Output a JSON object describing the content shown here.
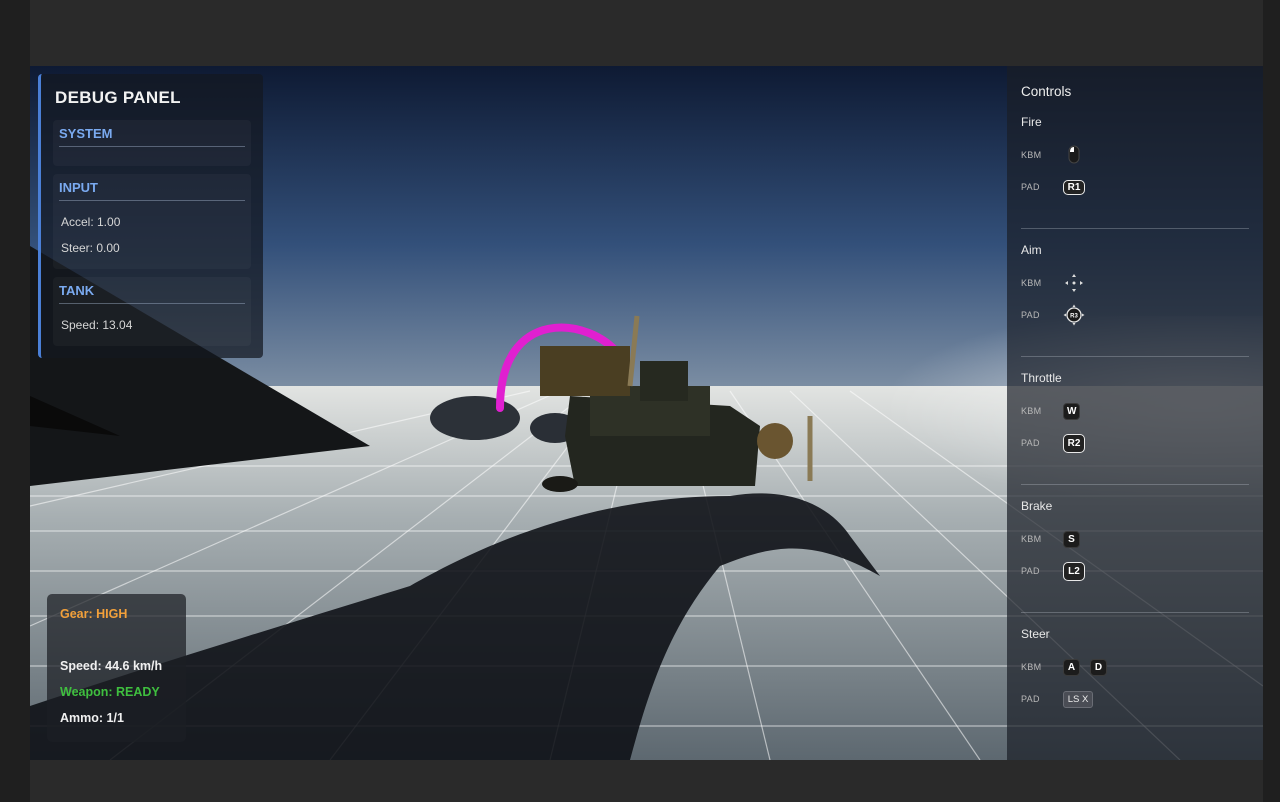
{
  "debug_panel": {
    "title": "DEBUG PANEL",
    "sections": [
      {
        "title": "SYSTEM",
        "rows": []
      },
      {
        "title": "INPUT",
        "rows": [
          "Accel: 1.00",
          "Steer: 0.00"
        ]
      },
      {
        "title": "TANK",
        "rows": [
          "Speed: 13.04"
        ]
      }
    ]
  },
  "hud": {
    "gear": "Gear: HIGH",
    "speed": "Speed: 44.6 km/h",
    "weapon": "Weapon: READY",
    "ammo": "Ammo: 1/1"
  },
  "controls": {
    "title": "Controls",
    "device_kbm": "KBM",
    "device_pad": "PAD",
    "groups": [
      {
        "name": "Fire",
        "kbm": {
          "icon": "mouse-left-click-icon"
        },
        "pad": {
          "label": "R1"
        }
      },
      {
        "name": "Aim",
        "kbm": {
          "icon": "mouse-move-icon"
        },
        "pad": {
          "icon": "right-stick-r3-icon",
          "label": "R3"
        }
      },
      {
        "name": "Throttle",
        "kbm": {
          "label": "W"
        },
        "pad": {
          "label": "R2"
        }
      },
      {
        "name": "Brake",
        "kbm": {
          "label": "S"
        },
        "pad": {
          "label": "L2"
        }
      },
      {
        "name": "Steer",
        "kbm": {
          "labels": [
            "A",
            "D"
          ]
        },
        "pad": {
          "label": "LS X"
        }
      }
    ]
  },
  "colors": {
    "accent_blue": "#4a7fd6",
    "section_title": "#7aaaf0",
    "gear_orange": "#f2a03a",
    "weapon_green": "#3fbf3f",
    "trajectory_magenta": "#e020d0"
  }
}
